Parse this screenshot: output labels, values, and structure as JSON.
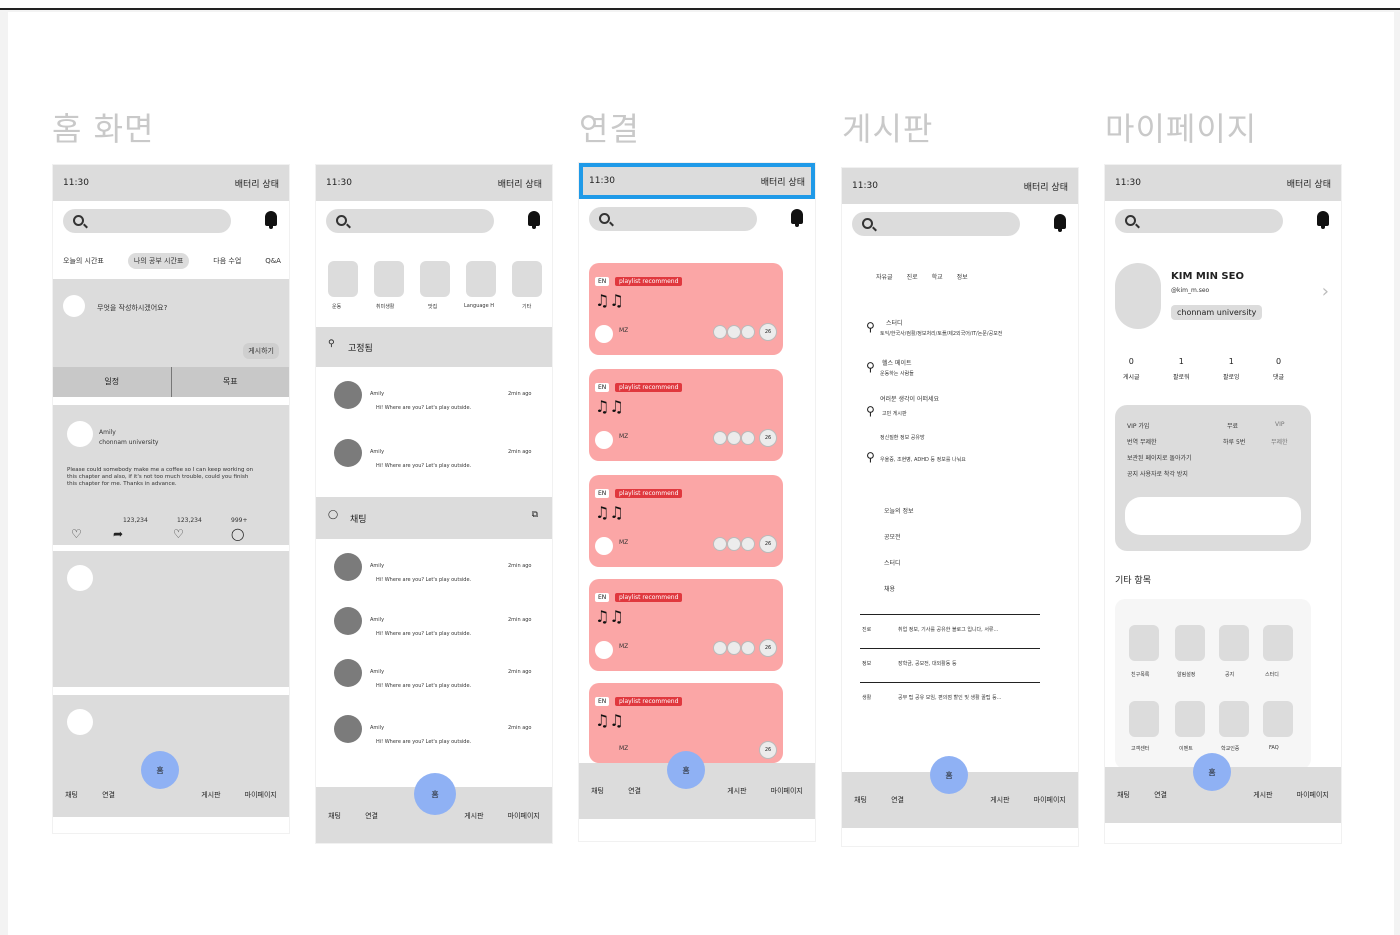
{
  "sections": [
    "홈 화면",
    "연결",
    "게시판",
    "마이페이지"
  ],
  "status": {
    "time": "11:30",
    "right": "배터리 상태"
  },
  "nav": {
    "chat": "채팅",
    "connect": "연결",
    "home": "홈",
    "board": "게시판",
    "mypage": "마이페이지"
  },
  "home": {
    "tabs": [
      "오늘의 시간표",
      "나의 공부 시간표",
      "다음 수업",
      "Q&A"
    ],
    "prompt": "무엇을 작성하시겠어요?",
    "write_btn": "게시하기",
    "toggle_left": "일정",
    "toggle_right": "목표",
    "post_user": "Amily",
    "post_univ": "chonnam university",
    "post_body": "Please could somebody make me a coffee so I can keep working on this chapter and also, if it's not too much trouble, could you finish this chapter for me. Thanks in advance.",
    "count1": "123,234",
    "count2": "123,234",
    "count3": "999+"
  },
  "friends": {
    "icons": [
      "운동",
      "취미생활",
      "맛집",
      "Language H",
      "기타"
    ],
    "group_title": "고정됨",
    "chat_title": "채팅",
    "user": "Amily",
    "msg": "Hi! Where are you? Let's play outside.",
    "time": "2min ago"
  },
  "connect": {
    "lang": "EN",
    "tag": "playlist recommend",
    "notes": "♫♫",
    "name": "MZ",
    "count": "26"
  },
  "board": {
    "filters": [
      "자유글",
      "진로",
      "학교",
      "정보"
    ],
    "posts": [
      {
        "title": "스터디",
        "sub": "토익/한국사/컴활/정보처리/토플/제2외국어/IT/논문/공모전"
      },
      {
        "title": "헬스 메이트",
        "sub": "운동하는 사람들"
      },
      {
        "title": "여러분 생각이 어떠세요",
        "sub": "고민 게시판"
      },
      {
        "title": "정신질환 정보 공유방",
        "sub": "우울증, 조현병, ADHD 등 정보를 나눠요"
      }
    ],
    "cats": [
      "오늘의 정보",
      "공모전",
      "스터디",
      "채용"
    ],
    "list": [
      {
        "k": "진로",
        "v": "취업 정보, 기사를 공유한 블로그 입니다, 서류..."
      },
      {
        "k": "정보",
        "v": "장학금, 공모전, 대외활동 등"
      },
      {
        "k": "생활",
        "v": "공부 팁 공유 모임, 편의점 할인 및 생활 꿀팁 등..."
      }
    ]
  },
  "mypage": {
    "name": "KIM MIN SEO",
    "handle": "@kim_m.seo",
    "univ": "chonnam university",
    "stats": [
      {
        "n": "0",
        "l": "게시글"
      },
      {
        "n": "1",
        "l": "팔로워"
      },
      {
        "n": "1",
        "l": "팔로잉"
      },
      {
        "n": "0",
        "l": "댓글"
      }
    ],
    "vip_left": [
      "VIP 가입",
      "번역 무제한",
      "보관된 페이지로 돌아가기",
      "공지 사용자로 착각 방지"
    ],
    "vip_mid": [
      "무료",
      "하루 5번"
    ],
    "vip_right": [
      "VIP",
      "무제한"
    ],
    "other_title": "기타 항목",
    "icons_row1": [
      "친구목록",
      "알림설정",
      "공지",
      "스터디"
    ],
    "icons_row2": [
      "고객센터",
      "이벤트",
      "학교인증",
      "FAQ"
    ]
  }
}
